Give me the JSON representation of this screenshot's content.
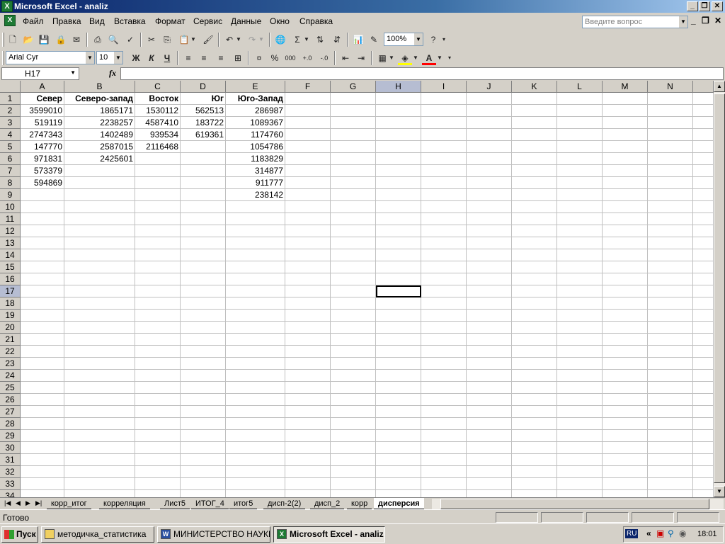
{
  "window": {
    "title": "Microsoft Excel - analiz"
  },
  "menu": {
    "items": [
      "Файл",
      "Правка",
      "Вид",
      "Вставка",
      "Формат",
      "Сервис",
      "Данные",
      "Окно",
      "Справка"
    ],
    "help_placeholder": "Введите вопрос"
  },
  "toolbar": {
    "zoom": "100%"
  },
  "format_toolbar": {
    "font": "Arial Cyr",
    "size": "10",
    "bold": "Ж",
    "italic": "К",
    "underline": "Ч"
  },
  "formula": {
    "namebox": "H17",
    "fx": "fx"
  },
  "sheet": {
    "columns": [
      "A",
      "B",
      "C",
      "D",
      "E",
      "F",
      "G",
      "H",
      "I",
      "J",
      "K",
      "L",
      "M",
      "N"
    ],
    "rows": [
      "1",
      "2",
      "3",
      "4",
      "5",
      "6",
      "7",
      "8",
      "9",
      "10",
      "11",
      "12",
      "13",
      "14",
      "15",
      "16",
      "17",
      "18",
      "19",
      "20",
      "21",
      "22",
      "23",
      "24",
      "25",
      "26",
      "27",
      "28",
      "29",
      "30",
      "31",
      "32",
      "33",
      "34"
    ],
    "header": [
      "Север",
      "Северо-запад",
      "Восток",
      "Юг",
      "Юго-Запад"
    ],
    "data": [
      [
        "3599010",
        "1865171",
        "1530112",
        "562513",
        "286987"
      ],
      [
        "519119",
        "2238257",
        "4587410",
        "183722",
        "1089367"
      ],
      [
        "2747343",
        "1402489",
        "939534",
        "619361",
        "1174760"
      ],
      [
        "147770",
        "2587015",
        "2116468",
        "",
        "1054786"
      ],
      [
        "971831",
        "2425601",
        "",
        "",
        "1183829"
      ],
      [
        "573379",
        "",
        "",
        "",
        "314877"
      ],
      [
        "594869",
        "",
        "",
        "",
        "911777"
      ],
      [
        "",
        "",
        "",
        "",
        "238142"
      ]
    ],
    "active_cell": "H17"
  },
  "tabs": [
    "корр_итог",
    "корреляция",
    "Лист5",
    "ИТОГ_4",
    "итог5",
    "дисп-2(2)",
    "дисп_2",
    "корр",
    "дисперсия"
  ],
  "active_tab": "дисперсия",
  "status": {
    "text": "Готово"
  },
  "taskbar": {
    "start": "Пуск",
    "tasks": [
      "методичка_статистика",
      "МИНИСТЕРСТВО НАУКИ...",
      "Microsoft Excel - analiz"
    ],
    "lang": "RU",
    "clock": "18:01"
  }
}
